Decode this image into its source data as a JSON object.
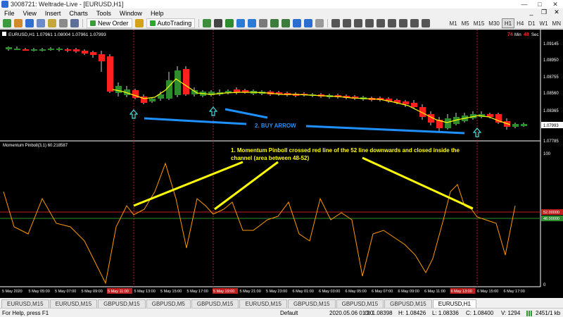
{
  "window": {
    "title": "3008721: Weltrade-Live - [EURUSD,H1]"
  },
  "menu": [
    "File",
    "View",
    "Insert",
    "Charts",
    "Tools",
    "Window",
    "Help"
  ],
  "toolbar": {
    "new_order": "New Order",
    "autotrading": "AutoTrading"
  },
  "timeframes": [
    {
      "label": "M1",
      "active": false
    },
    {
      "label": "M5",
      "active": false
    },
    {
      "label": "M15",
      "active": false
    },
    {
      "label": "M30",
      "active": false
    },
    {
      "label": "H1",
      "active": true
    },
    {
      "label": "H4",
      "active": false
    },
    {
      "label": "D1",
      "active": false
    },
    {
      "label": "W1",
      "active": false
    },
    {
      "label": "MN",
      "active": false
    }
  ],
  "chart": {
    "header": "EURUSD,H1  1.07961 1.08004 1.07961 1.07993",
    "timer": {
      "minutes": "74",
      "min_label": "Min",
      "seconds": "48",
      "sec_label": "Sec"
    },
    "price_labels": [
      "1.09145",
      "1.08950",
      "1.08755",
      "1.08560",
      "1.08365",
      "1.08175",
      "1.07785"
    ],
    "current_price": "1.07993",
    "buy_arrow_label": "2.  BUY ARROW",
    "indicator_header": "Momentum Pinboll(3,1) 60.218587",
    "indicator_scale": [
      "100",
      "0"
    ],
    "level_52": "52.00000",
    "level_48": "48.00000",
    "annotation": "1.  Momentum Pinboll crossed red line of the 52 line downwards and closed inside the channel (area between 48-52)",
    "time_labels": [
      "5 May 2020",
      "5 May 05:00",
      "5 May 07:00",
      "5 May 09:00",
      "5 May 11:00",
      "5 May 13:00",
      "5 May 15:00",
      "5 May 17:00",
      "5 May 19:00",
      "5 May 21:00",
      "5 May 23:00",
      "6 May 01:00",
      "6 May 03:00",
      "6 May 05:00",
      "6 May 07:00",
      "6 May 09:00",
      "6 May 11:00",
      "6 May 13:00",
      "6 May 15:00",
      "6 May 17:00"
    ],
    "time_highlights": [
      "5 May 11:00",
      "5 May 19:00",
      "6 May 13:00"
    ],
    "colors": {
      "bull": "#2e8b2e",
      "bear": "#ff2020",
      "ma": "#ffff00",
      "arrow": "#40e0e0",
      "annotation": "#ffff00",
      "osc": "#ff9900",
      "blue_line": "#1e90ff"
    }
  },
  "tabs": [
    {
      "label": "EURUSD,M15",
      "active": false
    },
    {
      "label": "EURUSD,M15",
      "active": false
    },
    {
      "label": "GBPUSD,M15",
      "active": false
    },
    {
      "label": "GBPUSD,M5",
      "active": false
    },
    {
      "label": "GBPUSD,M15",
      "active": false
    },
    {
      "label": "EURUSD,M15",
      "active": false
    },
    {
      "label": "GBPUSD,M15",
      "active": false
    },
    {
      "label": "GBPUSD,M15",
      "active": false
    },
    {
      "label": "GBPUSD,M15",
      "active": false
    },
    {
      "label": "EURUSD,H1",
      "active": true
    }
  ],
  "status": {
    "help": "For Help, press F1",
    "profile": "Default",
    "datetime": "2020.05.06 01:00",
    "open": "O: 1.08398",
    "high": "H: 1.08426",
    "low": "L: 1.08336",
    "close": "C: 1.08400",
    "volume": "V: 1294",
    "traffic": "2451/1 kb"
  }
}
